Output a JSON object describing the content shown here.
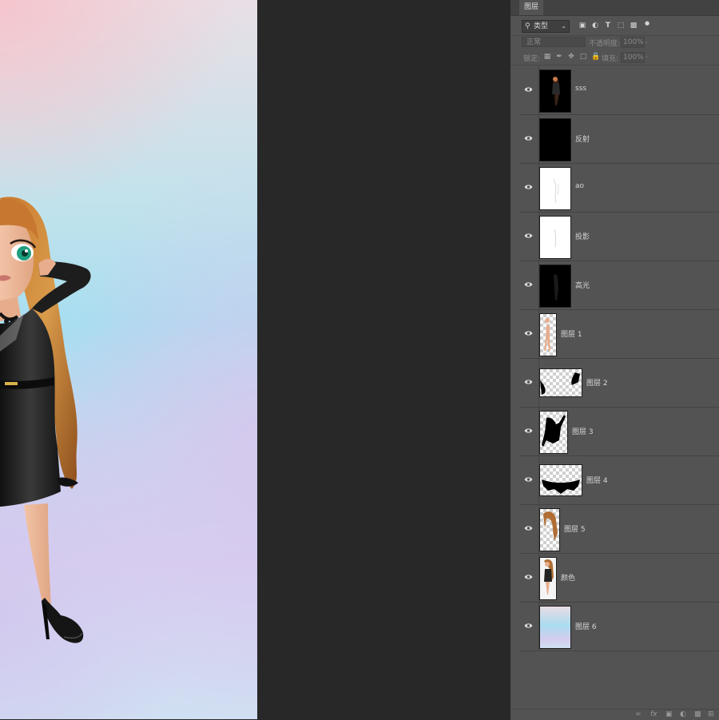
{
  "panel": {
    "tab": "图层",
    "filter": {
      "kind_label": "类型"
    },
    "blend_mode": "正常",
    "opacity_label": "不透明度:",
    "opacity_value": "100%",
    "lock_label": "锁定:",
    "fill_label": "填充:",
    "fill_value": "100%"
  },
  "layers": [
    {
      "name": "sss",
      "thumb": "dark-figure",
      "visible": true
    },
    {
      "name": "反射",
      "thumb": "black",
      "visible": true
    },
    {
      "name": "ao",
      "thumb": "white-sketch",
      "visible": true
    },
    {
      "name": "投影",
      "thumb": "white-sketch",
      "visible": true
    },
    {
      "name": "高光",
      "thumb": "dark-figure-dim",
      "visible": true
    },
    {
      "name": "图层 1",
      "thumb": "transparent-skin",
      "visible": true
    },
    {
      "name": "图层 2",
      "thumb": "transparent-wide",
      "visible": true
    },
    {
      "name": "图层 3",
      "thumb": "transparent-dress",
      "visible": true
    },
    {
      "name": "图层 4",
      "thumb": "transparent-wide-beads",
      "visible": true
    },
    {
      "name": "图层 5",
      "thumb": "transparent-hair",
      "visible": true
    },
    {
      "name": "颜色",
      "thumb": "color-figure",
      "visible": true
    },
    {
      "name": "图层 6",
      "thumb": "gradient",
      "visible": true
    }
  ],
  "colors": {
    "panel_bg": "#535353",
    "workspace": "#282828",
    "tab_bar": "#424242"
  }
}
